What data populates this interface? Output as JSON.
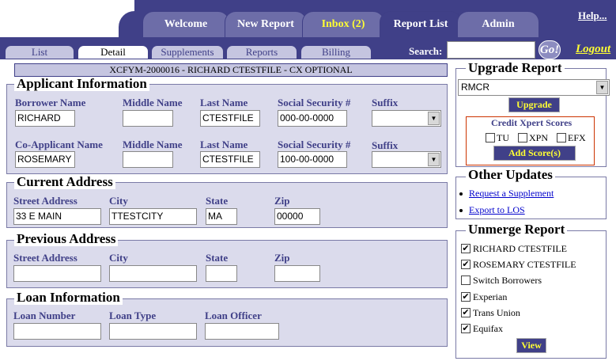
{
  "header": {
    "tabs": [
      {
        "label": "Welcome"
      },
      {
        "label": "New Report"
      },
      {
        "label": "Inbox (2)"
      },
      {
        "label": "Report List"
      },
      {
        "label": "Admin"
      }
    ],
    "help_label": "Help..."
  },
  "subnav": {
    "tabs": [
      {
        "label": "List"
      },
      {
        "label": "Detail"
      },
      {
        "label": "Supplements"
      },
      {
        "label": "Reports"
      },
      {
        "label": "Billing"
      }
    ],
    "search_label": "Search:",
    "search_value": "",
    "go_label": "Go!",
    "logout_label": "Logout"
  },
  "report_title": "XCFYM-2000016 - RICHARD CTESTFILE - CX OPTIONAL",
  "applicant": {
    "legend": "Applicant Information",
    "labels": {
      "borrower": "Borrower Name",
      "middle": "Middle Name",
      "last": "Last Name",
      "ssn": "Social Security #",
      "suffix": "Suffix",
      "coapp": "Co-Applicant Name"
    },
    "borrower": {
      "first": "RICHARD",
      "middle": "",
      "last": "CTESTFILE",
      "ssn": "000-00-0000",
      "suffix": ""
    },
    "coapplicant": {
      "first": "ROSEMARY",
      "middle": "",
      "last": "CTESTFILE",
      "ssn": "100-00-0000",
      "suffix": ""
    }
  },
  "current_address": {
    "legend": "Current Address",
    "labels": {
      "street": "Street Address",
      "city": "City",
      "state": "State",
      "zip": "Zip"
    },
    "street": "33 E MAIN",
    "city": "TTESTCITY",
    "state": "MA",
    "zip": "00000"
  },
  "previous_address": {
    "legend": "Previous Address",
    "labels": {
      "street": "Street Address",
      "city": "City",
      "state": "State",
      "zip": "Zip"
    },
    "street": "",
    "city": "",
    "state": "",
    "zip": ""
  },
  "loan": {
    "legend": "Loan Information",
    "labels": {
      "number": "Loan Number",
      "type": "Loan Type",
      "officer": "Loan Officer"
    },
    "number": "",
    "type": "",
    "officer": ""
  },
  "upgrade": {
    "legend": "Upgrade Report",
    "selected": "RMCR",
    "upgrade_label": "Upgrade",
    "scores_title": "Credit Xpert Scores",
    "scores": [
      {
        "label": "TU"
      },
      {
        "label": "XPN"
      },
      {
        "label": "EFX"
      }
    ],
    "add_scores_label": "Add Score(s)"
  },
  "other_updates": {
    "legend": "Other Updates",
    "links": [
      {
        "label": "Request a Supplement"
      },
      {
        "label": "Export to LOS"
      }
    ]
  },
  "unmerge": {
    "legend": "Unmerge Report",
    "items": [
      {
        "label": "RICHARD CTESTFILE",
        "checked": true
      },
      {
        "label": "ROSEMARY CTESTFILE",
        "checked": true
      },
      {
        "label": "Switch Borrowers",
        "checked": false
      },
      {
        "label": "Experian",
        "checked": true
      },
      {
        "label": "Trans Union",
        "checked": true
      },
      {
        "label": "Equifax",
        "checked": true
      }
    ],
    "view_label": "View"
  },
  "colors": {
    "navy": "#404088",
    "tab": "#6d6da8",
    "yellow": "#ffff33",
    "panel": "#dbdbec"
  }
}
